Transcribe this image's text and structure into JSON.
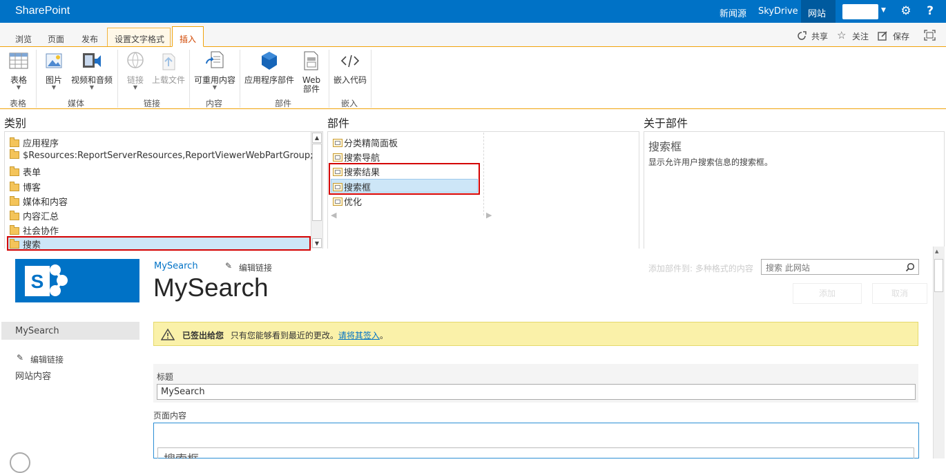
{
  "suitebar": {
    "brand": "SharePoint",
    "links": [
      "新闻源",
      "SkyDrive",
      "网站"
    ],
    "active_link_index": 2
  },
  "tabs": [
    "浏览",
    "页面",
    "发布",
    "设置文字格式",
    "插入"
  ],
  "actions": {
    "share": "共享",
    "follow": "关注",
    "save": "保存"
  },
  "ribbon": {
    "table": "表格",
    "picture": "图片",
    "video_audio": "视频和音频",
    "link": "链接",
    "upload": "上载文件",
    "reusable": "可重用内容",
    "app_part": "应用程序部件",
    "web_part_1": "Web",
    "web_part_2": "部件",
    "embed": "嵌入代码",
    "groups": {
      "table": "表格",
      "media": "媒体",
      "links": "链接",
      "content": "内容",
      "parts": "部件",
      "embed": "嵌入"
    }
  },
  "picker": {
    "categories_title": "类别",
    "parts_title": "部件",
    "about_title": "关于部件",
    "categories": [
      "应用程序",
      "$Resources:ReportServerResources,ReportViewerWebPartGroup;",
      "表单",
      "博客",
      "媒体和内容",
      "内容汇总",
      "社会协作",
      "搜索"
    ],
    "selected_category_index": 7,
    "parts": [
      "分类精简面板",
      "搜索导航",
      "搜索结果",
      "搜索框",
      "优化"
    ],
    "selected_part_index": 3,
    "about_name": "搜索框",
    "about_desc": "显示允许用户搜索信息的搜索框。",
    "add_to": "添加部件到: 多种格式的内容",
    "add_btn": "添加",
    "cancel_btn": "取消"
  },
  "page": {
    "crumb_site": "MySearch",
    "edit_links": "编辑链接",
    "title": "MySearch",
    "search_placeholder": "搜索 此网站",
    "nav_items": [
      "MySearch"
    ],
    "nav_edit_links": "编辑链接",
    "nav_site_contents": "网站内容",
    "notice_bold": "已签出给您",
    "notice_text": "只有您能够看到最近的更改。",
    "notice_link": "请将其签入",
    "notice_end": "。",
    "field_title_label": "标题",
    "field_title_value": "MySearch",
    "page_content_label": "页面内容",
    "content_part_heading": "搜索框"
  },
  "colors": {
    "suitebar": "#0072C6",
    "ribbon_accent": "#f0a30a",
    "highlight": "#d40000",
    "notice": "#faf1a9"
  }
}
